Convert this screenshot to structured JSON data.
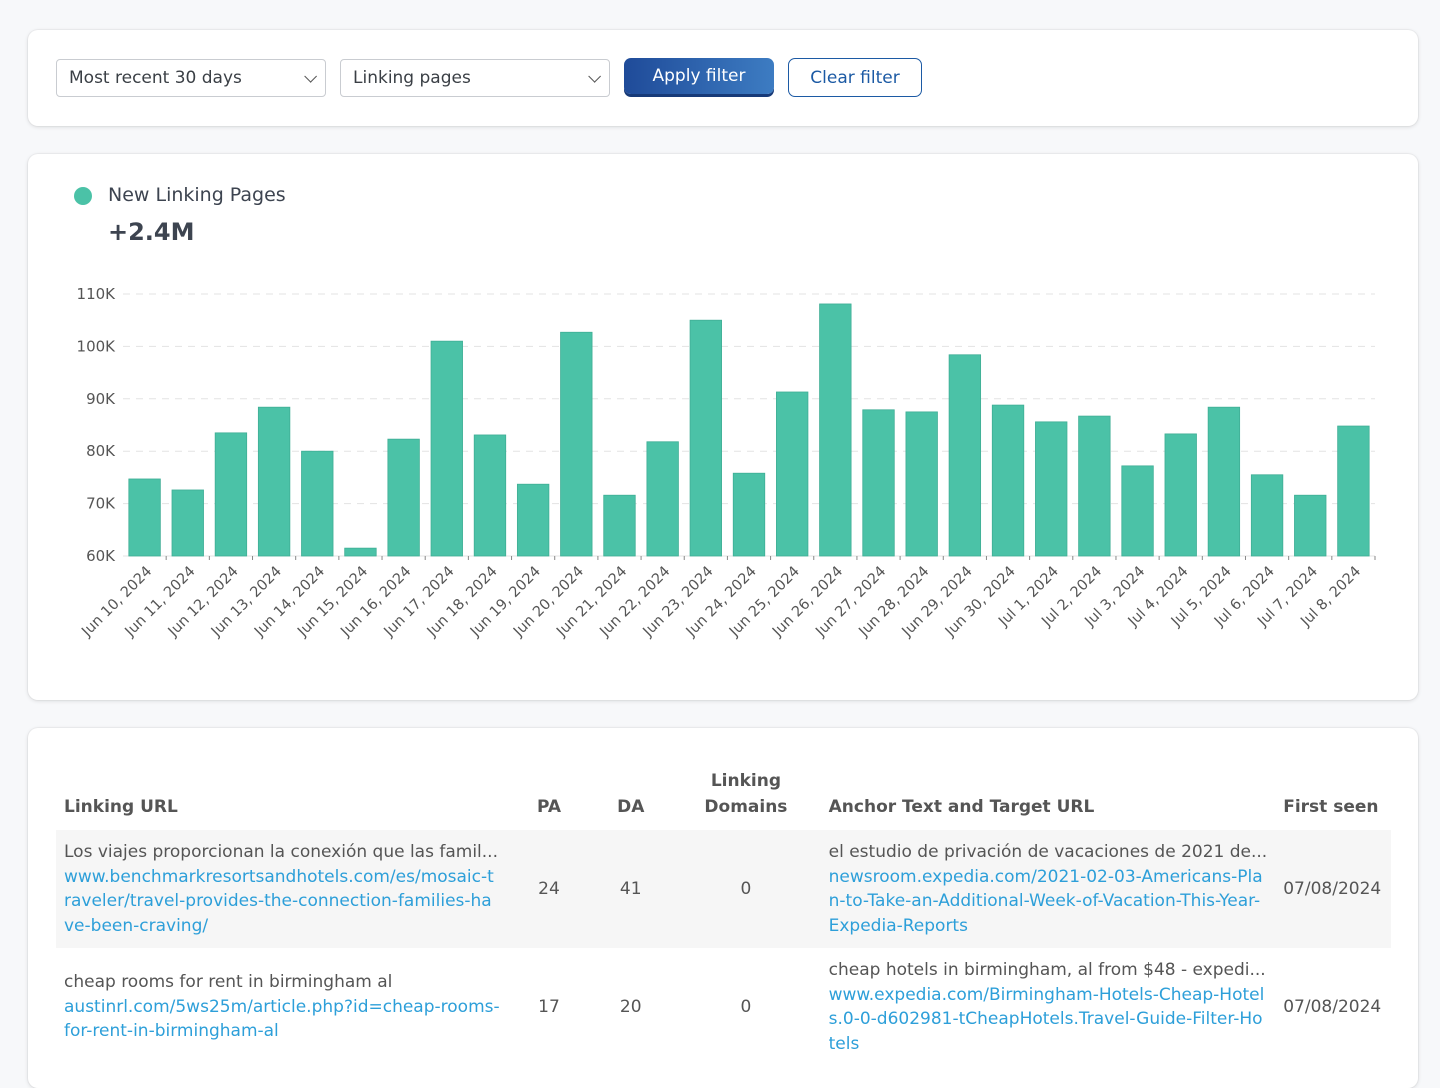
{
  "filters": {
    "range_select": "Most recent 30 days",
    "metric_select": "Linking pages",
    "apply_label": "Apply filter",
    "clear_label": "Clear filter"
  },
  "chart_panel": {
    "legend_label": "New Linking Pages",
    "legend_color": "#4bc2a7",
    "total": "+2.4M"
  },
  "chart_data": {
    "type": "bar",
    "title": "",
    "xlabel": "",
    "ylabel": "",
    "ylim": [
      60000,
      110000
    ],
    "yticks": [
      "60K",
      "70K",
      "80K",
      "90K",
      "100K",
      "110K"
    ],
    "ytick_values": [
      60000,
      70000,
      80000,
      90000,
      100000,
      110000
    ],
    "grid": true,
    "legend": "top-left",
    "bar_color": "#4bc2a7",
    "categories": [
      "Jun 10, 2024",
      "Jun 11, 2024",
      "Jun 12, 2024",
      "Jun 13, 2024",
      "Jun 14, 2024",
      "Jun 15, 2024",
      "Jun 16, 2024",
      "Jun 17, 2024",
      "Jun 18, 2024",
      "Jun 19, 2024",
      "Jun 20, 2024",
      "Jun 21, 2024",
      "Jun 22, 2024",
      "Jun 23, 2024",
      "Jun 24, 2024",
      "Jun 25, 2024",
      "Jun 26, 2024",
      "Jun 27, 2024",
      "Jun 28, 2024",
      "Jun 29, 2024",
      "Jun 30, 2024",
      "Jul 1, 2024",
      "Jul 2, 2024",
      "Jul 3, 2024",
      "Jul 4, 2024",
      "Jul 5, 2024",
      "Jul 6, 2024",
      "Jul 7, 2024",
      "Jul 8, 2024"
    ],
    "series": [
      {
        "name": "New Linking Pages",
        "values": [
          74700,
          72600,
          83500,
          88400,
          80000,
          61500,
          82300,
          101000,
          83100,
          73700,
          102700,
          71600,
          81800,
          105000,
          75800,
          91300,
          108100,
          87900,
          87500,
          98400,
          88800,
          85600,
          86700,
          77200,
          83300,
          88400,
          75500,
          71600,
          84800
        ]
      }
    ]
  },
  "table": {
    "headers": {
      "linking_url": "Linking URL",
      "pa": "PA",
      "da": "DA",
      "linking_domains_1": "Linking",
      "linking_domains_2": "Domains",
      "anchor": "Anchor Text and Target URL",
      "first_seen": "First seen"
    },
    "rows": [
      {
        "title": "Los viajes proporcionan la conexión que las famil...",
        "url": "www.benchmarkresortsandhotels.com/es/mosaic-traveler/travel-provides-the-connection-families-have-been-craving/",
        "pa": "24",
        "da": "41",
        "linking_domains": "0",
        "anchor_text": "el estudio de privación de vacaciones de 2021 de...",
        "target_url": "newsroom.expedia.com/2021-02-03-Americans-Plan-to-Take-an-Additional-Week-of-Vacation-This-Year-Expedia-Reports",
        "first_seen": "07/08/2024"
      },
      {
        "title": "cheap rooms for rent in birmingham al",
        "url": "austinrl.com/5ws25m/article.php?id=cheap-rooms-for-rent-in-birmingham-al",
        "pa": "17",
        "da": "20",
        "linking_domains": "0",
        "anchor_text": "cheap hotels in birmingham, al from $48 - expedi...",
        "target_url": "www.expedia.com/Birmingham-Hotels-Cheap-Hotels.0-0-d602981-tCheapHotels.Travel-Guide-Filter-Hotels",
        "first_seen": "07/08/2024"
      }
    ]
  }
}
